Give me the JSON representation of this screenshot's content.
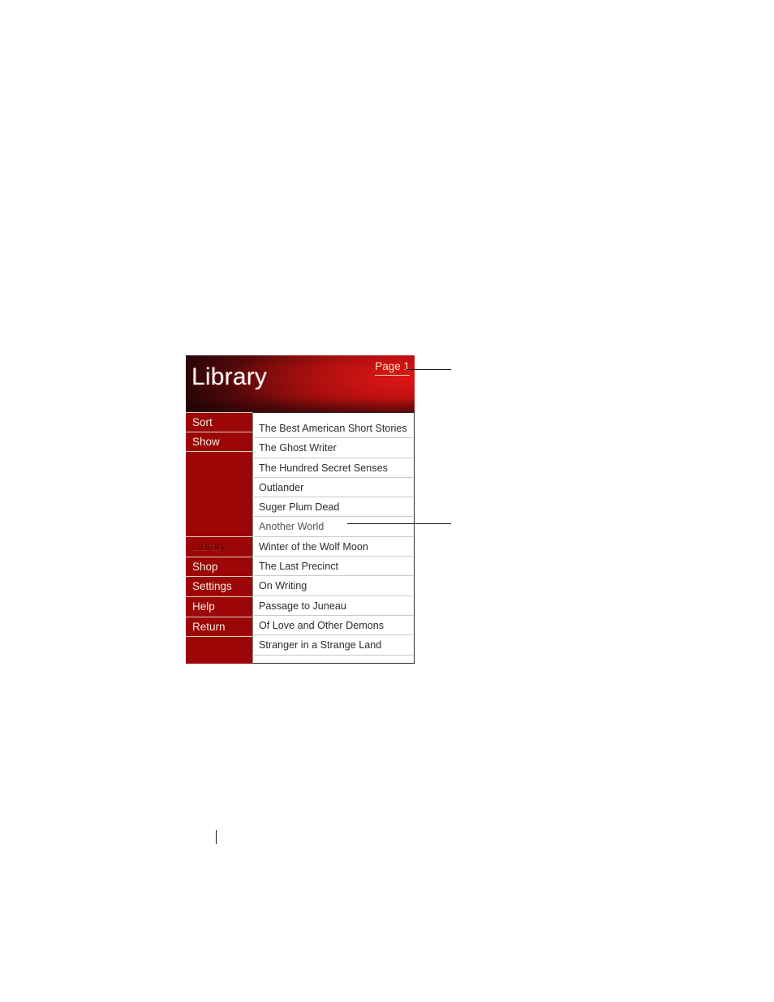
{
  "device": {
    "header": {
      "title": "Library",
      "page_indicator": "Page 1",
      "title_color": "#ffffff",
      "page_indicator_color": "#f2e3c6",
      "gradient_dark": "#160306",
      "gradient_bright": "#cc1313"
    },
    "sidebar": {
      "background_color": "#9c0606",
      "separator_color": "#d8cfc9",
      "active_item_color": "#5e0404",
      "item_color": "#f5ece0",
      "top_items": [
        {
          "label": "Sort",
          "active": false
        },
        {
          "label": "Show",
          "active": false
        }
      ],
      "bottom_items": [
        {
          "label": "Library",
          "active": true
        },
        {
          "label": "Shop",
          "active": false
        },
        {
          "label": "Settings",
          "active": false
        },
        {
          "label": "Help",
          "active": false
        },
        {
          "label": "Return",
          "active": false
        }
      ]
    },
    "book_list": {
      "border_color": "#2c2c2c",
      "row_separator_color": "#c9c9c9",
      "items": [
        {
          "title": "The Best American Short Stories",
          "dim": false
        },
        {
          "title": "The Ghost Writer",
          "dim": false
        },
        {
          "title": "The Hundred Secret Senses",
          "dim": false
        },
        {
          "title": "Outlander",
          "dim": false
        },
        {
          "title": "Suger Plum Dead",
          "dim": false
        },
        {
          "title": "Another World",
          "dim": true
        },
        {
          "title": "Winter of the Wolf Moon",
          "dim": false
        },
        {
          "title": "The Last Precinct",
          "dim": false
        },
        {
          "title": "On Writing",
          "dim": false
        },
        {
          "title": "Passage to Juneau",
          "dim": false
        },
        {
          "title": "Of Love and Other Demons",
          "dim": false
        },
        {
          "title": "Stranger in a Strange Land",
          "dim": false
        }
      ]
    }
  },
  "callouts": {
    "leader_color": "#1a1a1a",
    "lines": [
      {
        "points_to": "page-indicator"
      },
      {
        "points_to": "book-list-entry"
      }
    ]
  }
}
